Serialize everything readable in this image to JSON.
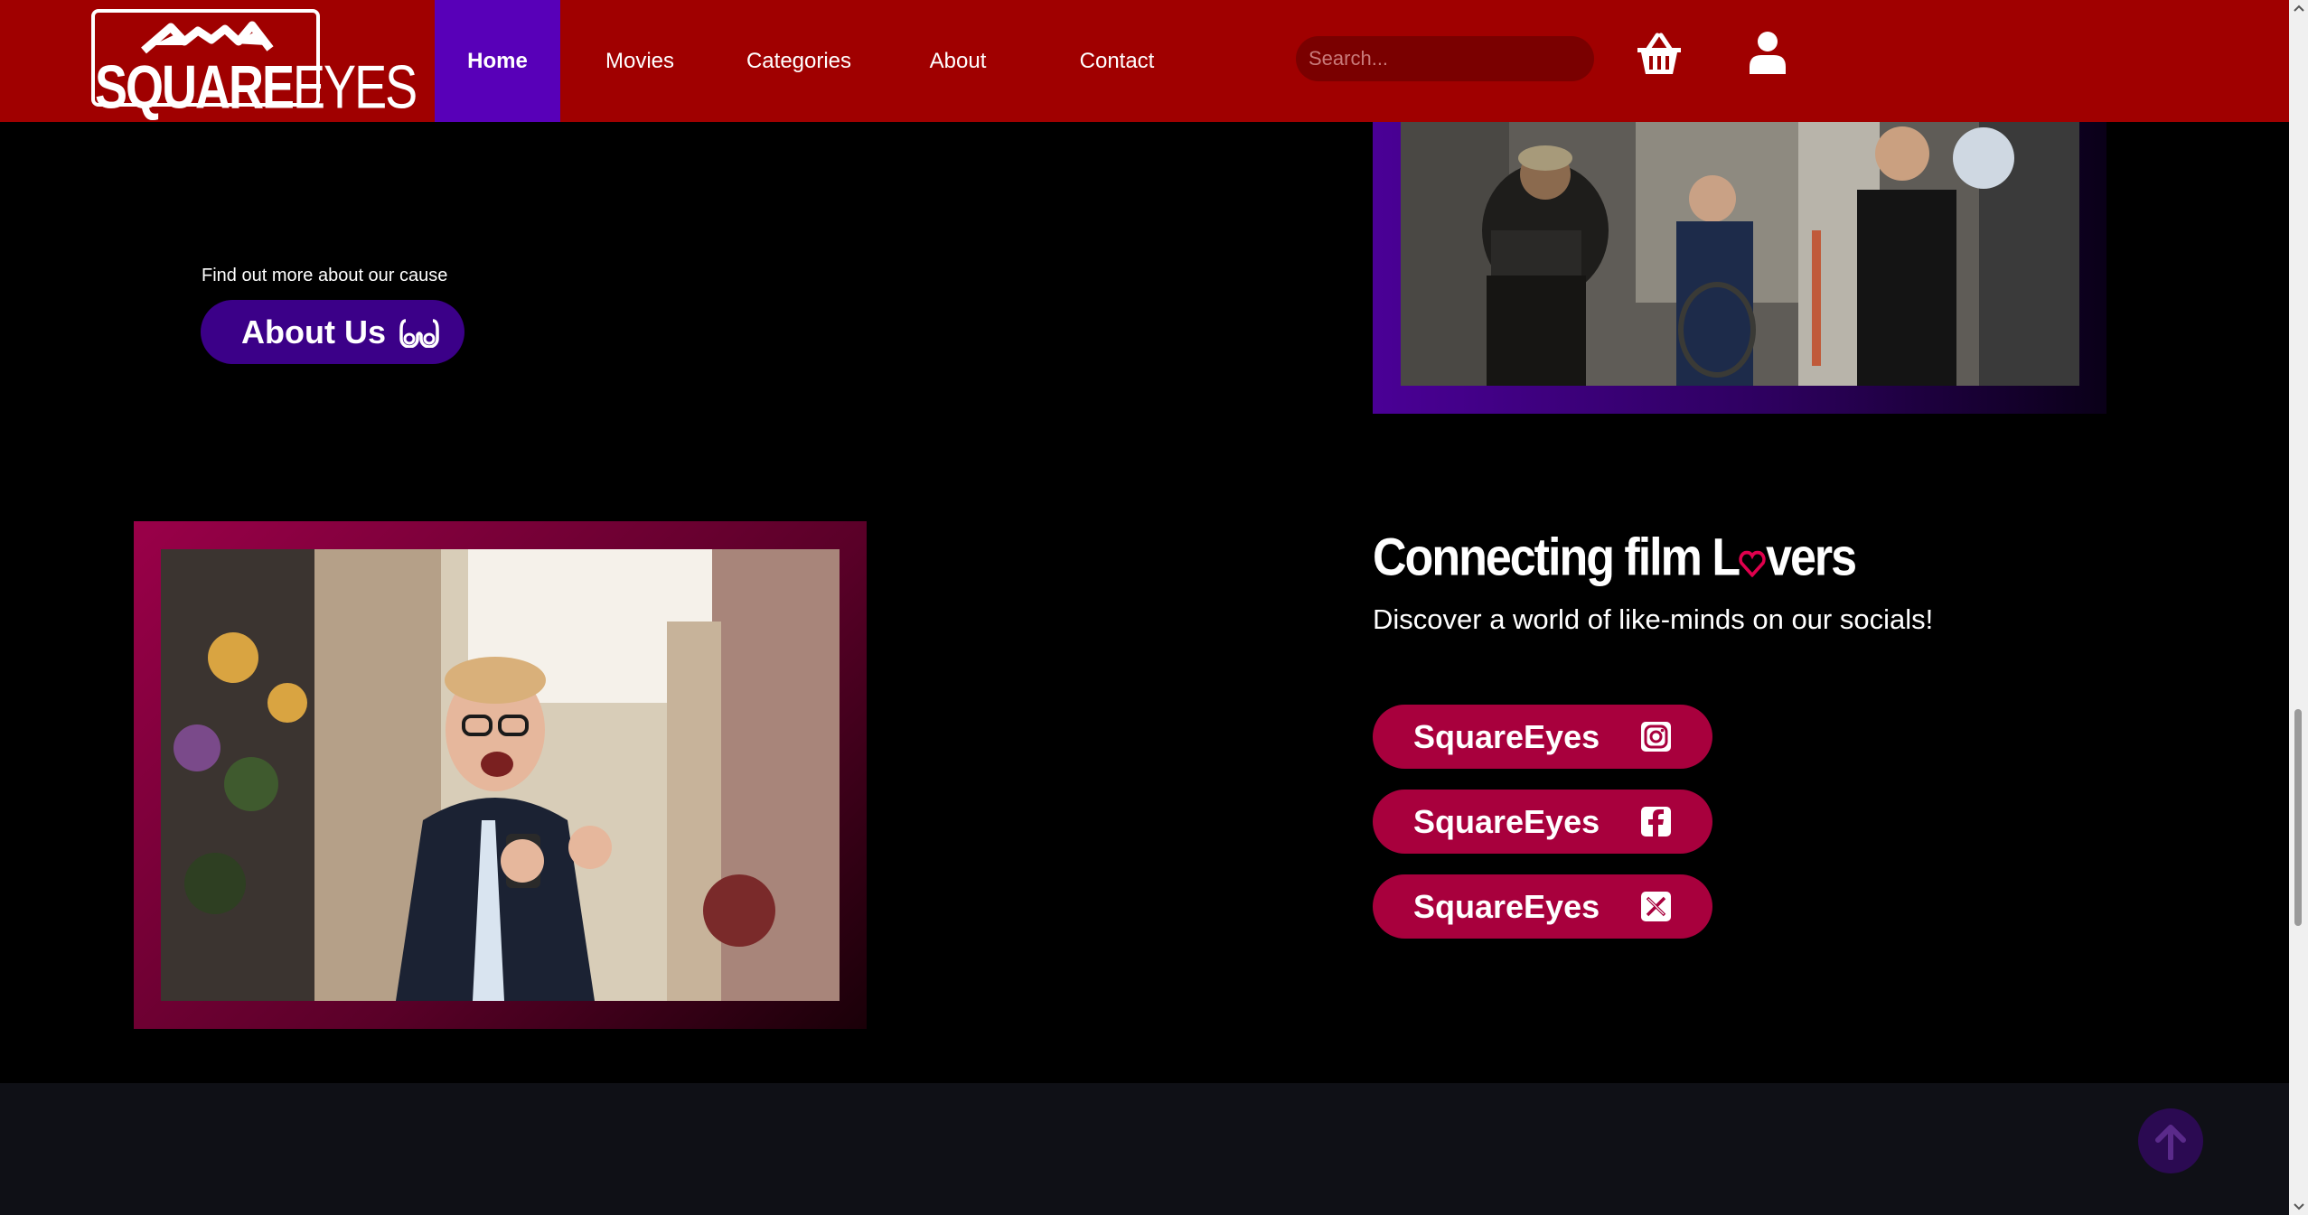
{
  "header": {
    "logo": {
      "text_bold": "SQUARE",
      "text_thin": "EYES"
    },
    "nav": [
      {
        "label": "Home",
        "active": true
      },
      {
        "label": "Movies",
        "active": false
      },
      {
        "label": "Categories",
        "active": false
      },
      {
        "label": "About",
        "active": false
      },
      {
        "label": "Contact",
        "active": false
      }
    ],
    "search": {
      "placeholder": "Search..."
    },
    "icons": {
      "cart": "basket-icon",
      "account": "user-icon"
    }
  },
  "about_section": {
    "caption": "Find out more about our cause",
    "button_label": "About Us",
    "button_icon": "glasses-icon"
  },
  "social_section": {
    "title_part1": "Connecting film L",
    "title_part2": "vers",
    "title_heart_icon": "heart-icon",
    "subtitle": "Discover a world of like-minds on our socials!",
    "buttons": [
      {
        "label": "SquareEyes",
        "icon": "instagram-icon"
      },
      {
        "label": "SquareEyes",
        "icon": "facebook-icon"
      },
      {
        "label": "SquareEyes",
        "icon": "x-twitter-icon"
      }
    ]
  },
  "footer": {
    "back_to_top_icon": "arrow-up-icon"
  },
  "colors": {
    "header_bg": "#a00000",
    "nav_active": "#5800b8",
    "about_button": "#3b0088",
    "social_button": "#a8003d",
    "footer_bg": "#0f1016"
  }
}
